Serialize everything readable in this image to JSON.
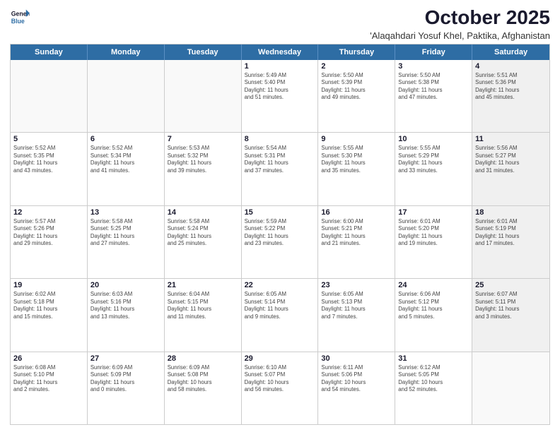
{
  "logo": {
    "line1": "General",
    "line2": "Blue"
  },
  "title": "October 2025",
  "subtitle": "'Alaqahdari Yosuf Khel, Paktika, Afghanistan",
  "days_of_week": [
    "Sunday",
    "Monday",
    "Tuesday",
    "Wednesday",
    "Thursday",
    "Friday",
    "Saturday"
  ],
  "weeks": [
    [
      {
        "day": "",
        "info": "",
        "empty": true
      },
      {
        "day": "",
        "info": "",
        "empty": true
      },
      {
        "day": "",
        "info": "",
        "empty": true
      },
      {
        "day": "1",
        "info": "Sunrise: 5:49 AM\nSunset: 5:40 PM\nDaylight: 11 hours\nand 51 minutes."
      },
      {
        "day": "2",
        "info": "Sunrise: 5:50 AM\nSunset: 5:39 PM\nDaylight: 11 hours\nand 49 minutes."
      },
      {
        "day": "3",
        "info": "Sunrise: 5:50 AM\nSunset: 5:38 PM\nDaylight: 11 hours\nand 47 minutes."
      },
      {
        "day": "4",
        "info": "Sunrise: 5:51 AM\nSunset: 5:36 PM\nDaylight: 11 hours\nand 45 minutes.",
        "shaded": true
      }
    ],
    [
      {
        "day": "5",
        "info": "Sunrise: 5:52 AM\nSunset: 5:35 PM\nDaylight: 11 hours\nand 43 minutes."
      },
      {
        "day": "6",
        "info": "Sunrise: 5:52 AM\nSunset: 5:34 PM\nDaylight: 11 hours\nand 41 minutes."
      },
      {
        "day": "7",
        "info": "Sunrise: 5:53 AM\nSunset: 5:32 PM\nDaylight: 11 hours\nand 39 minutes."
      },
      {
        "day": "8",
        "info": "Sunrise: 5:54 AM\nSunset: 5:31 PM\nDaylight: 11 hours\nand 37 minutes."
      },
      {
        "day": "9",
        "info": "Sunrise: 5:55 AM\nSunset: 5:30 PM\nDaylight: 11 hours\nand 35 minutes."
      },
      {
        "day": "10",
        "info": "Sunrise: 5:55 AM\nSunset: 5:29 PM\nDaylight: 11 hours\nand 33 minutes."
      },
      {
        "day": "11",
        "info": "Sunrise: 5:56 AM\nSunset: 5:27 PM\nDaylight: 11 hours\nand 31 minutes.",
        "shaded": true
      }
    ],
    [
      {
        "day": "12",
        "info": "Sunrise: 5:57 AM\nSunset: 5:26 PM\nDaylight: 11 hours\nand 29 minutes."
      },
      {
        "day": "13",
        "info": "Sunrise: 5:58 AM\nSunset: 5:25 PM\nDaylight: 11 hours\nand 27 minutes."
      },
      {
        "day": "14",
        "info": "Sunrise: 5:58 AM\nSunset: 5:24 PM\nDaylight: 11 hours\nand 25 minutes."
      },
      {
        "day": "15",
        "info": "Sunrise: 5:59 AM\nSunset: 5:22 PM\nDaylight: 11 hours\nand 23 minutes."
      },
      {
        "day": "16",
        "info": "Sunrise: 6:00 AM\nSunset: 5:21 PM\nDaylight: 11 hours\nand 21 minutes."
      },
      {
        "day": "17",
        "info": "Sunrise: 6:01 AM\nSunset: 5:20 PM\nDaylight: 11 hours\nand 19 minutes."
      },
      {
        "day": "18",
        "info": "Sunrise: 6:01 AM\nSunset: 5:19 PM\nDaylight: 11 hours\nand 17 minutes.",
        "shaded": true
      }
    ],
    [
      {
        "day": "19",
        "info": "Sunrise: 6:02 AM\nSunset: 5:18 PM\nDaylight: 11 hours\nand 15 minutes."
      },
      {
        "day": "20",
        "info": "Sunrise: 6:03 AM\nSunset: 5:16 PM\nDaylight: 11 hours\nand 13 minutes."
      },
      {
        "day": "21",
        "info": "Sunrise: 6:04 AM\nSunset: 5:15 PM\nDaylight: 11 hours\nand 11 minutes."
      },
      {
        "day": "22",
        "info": "Sunrise: 6:05 AM\nSunset: 5:14 PM\nDaylight: 11 hours\nand 9 minutes."
      },
      {
        "day": "23",
        "info": "Sunrise: 6:05 AM\nSunset: 5:13 PM\nDaylight: 11 hours\nand 7 minutes."
      },
      {
        "day": "24",
        "info": "Sunrise: 6:06 AM\nSunset: 5:12 PM\nDaylight: 11 hours\nand 5 minutes."
      },
      {
        "day": "25",
        "info": "Sunrise: 6:07 AM\nSunset: 5:11 PM\nDaylight: 11 hours\nand 3 minutes.",
        "shaded": true
      }
    ],
    [
      {
        "day": "26",
        "info": "Sunrise: 6:08 AM\nSunset: 5:10 PM\nDaylight: 11 hours\nand 2 minutes."
      },
      {
        "day": "27",
        "info": "Sunrise: 6:09 AM\nSunset: 5:09 PM\nDaylight: 11 hours\nand 0 minutes."
      },
      {
        "day": "28",
        "info": "Sunrise: 6:09 AM\nSunset: 5:08 PM\nDaylight: 10 hours\nand 58 minutes."
      },
      {
        "day": "29",
        "info": "Sunrise: 6:10 AM\nSunset: 5:07 PM\nDaylight: 10 hours\nand 56 minutes."
      },
      {
        "day": "30",
        "info": "Sunrise: 6:11 AM\nSunset: 5:06 PM\nDaylight: 10 hours\nand 54 minutes."
      },
      {
        "day": "31",
        "info": "Sunrise: 6:12 AM\nSunset: 5:05 PM\nDaylight: 10 hours\nand 52 minutes."
      },
      {
        "day": "",
        "info": "",
        "empty": true,
        "shaded": true
      }
    ]
  ]
}
